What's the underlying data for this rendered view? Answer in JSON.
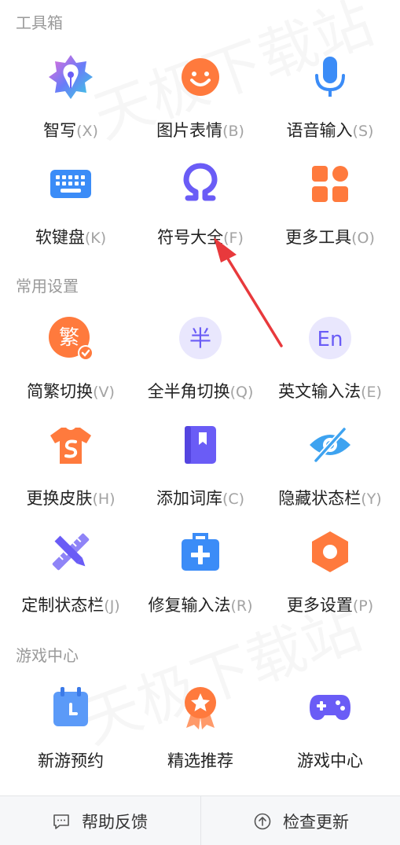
{
  "watermark": "天极下载站",
  "sections": [
    {
      "title": "工具箱",
      "rows": [
        [
          {
            "label": "智写",
            "key": "(X)",
            "icon": "smart-write-icon"
          },
          {
            "label": "图片表情",
            "key": "(B)",
            "icon": "emoji-icon"
          },
          {
            "label": "语音输入",
            "key": "(S)",
            "icon": "microphone-icon"
          }
        ],
        [
          {
            "label": "软键盘",
            "key": "(K)",
            "icon": "keyboard-icon"
          },
          {
            "label": "符号大全",
            "key": "(F)",
            "icon": "omega-symbol-icon"
          },
          {
            "label": "更多工具",
            "key": "(O)",
            "icon": "grid-apps-icon"
          }
        ]
      ]
    },
    {
      "title": "常用设置",
      "rows": [
        [
          {
            "label": "简繁切换",
            "key": "(V)",
            "icon": "traditional-chinese-icon",
            "icon_text": "繁"
          },
          {
            "label": "全半角切换",
            "key": "(Q)",
            "icon": "half-width-icon",
            "icon_text": "半"
          },
          {
            "label": "英文输入法",
            "key": "(E)",
            "icon": "english-input-icon",
            "icon_text": "En"
          }
        ],
        [
          {
            "label": "更换皮肤",
            "key": "(H)",
            "icon": "skin-shirt-icon"
          },
          {
            "label": "添加词库",
            "key": "(C)",
            "icon": "dictionary-icon"
          },
          {
            "label": "隐藏状态栏",
            "key": "(Y)",
            "icon": "eye-hidden-icon"
          }
        ],
        [
          {
            "label": "定制状态栏",
            "key": "(J)",
            "icon": "ruler-pencil-icon"
          },
          {
            "label": "修复输入法",
            "key": "(R)",
            "icon": "repair-kit-icon"
          },
          {
            "label": "更多设置",
            "key": "(P)",
            "icon": "settings-hexagon-icon"
          }
        ]
      ]
    },
    {
      "title": "游戏中心",
      "rows": [
        [
          {
            "label": "新游预约",
            "key": "",
            "icon": "calendar-icon"
          },
          {
            "label": "精选推荐",
            "key": "",
            "icon": "star-badge-icon"
          },
          {
            "label": "游戏中心",
            "key": "",
            "icon": "gamepad-icon"
          }
        ]
      ]
    }
  ],
  "footer": {
    "help_label": "帮助反馈",
    "update_label": "检查更新"
  },
  "colors": {
    "orange": "#ff7a3d",
    "blue": "#3b8cf7",
    "purple": "#6a5cf6",
    "arrow": "#e8393c"
  }
}
